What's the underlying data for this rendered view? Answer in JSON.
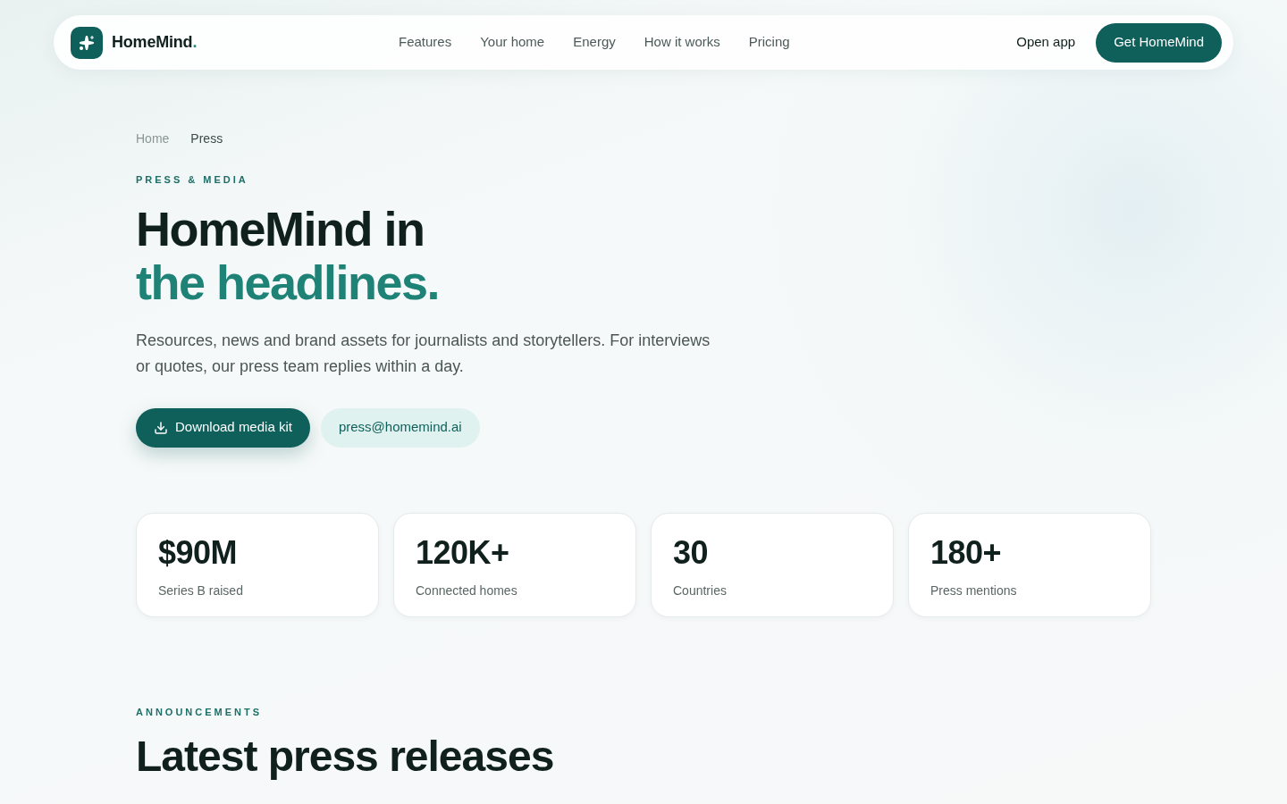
{
  "nav": {
    "brand": {
      "name": "HomeMind",
      "suffix": "."
    },
    "links": [
      "Features",
      "Your home",
      "Energy",
      "How it works",
      "Pricing"
    ],
    "open_app": "Open app",
    "cta": "Get HomeMind"
  },
  "breadcrumb": [
    {
      "label": "Home",
      "current": false
    },
    {
      "label": "Press",
      "current": true
    }
  ],
  "hero": {
    "eyebrow": "PRESS & MEDIA",
    "title": "HomeMind in",
    "title_accent": "the headlines.",
    "lead": "Resources, news and brand assets for journalists and storytellers. For interviews or quotes, our press team replies within a day.",
    "buttons": [
      {
        "kind": "primary",
        "label": "Download media kit"
      },
      {
        "kind": "secondary",
        "label": "press@homemind.ai"
      }
    ]
  },
  "stats": [
    {
      "value": "$90M",
      "label": "Series B raised"
    },
    {
      "value": "120K+",
      "label": "Connected homes"
    },
    {
      "value": "30",
      "label": "Countries"
    },
    {
      "value": "180+",
      "label": "Press mentions"
    }
  ],
  "announcements": {
    "eyebrow": "ANNOUNCEMENTS",
    "title": "Latest press releases"
  }
}
